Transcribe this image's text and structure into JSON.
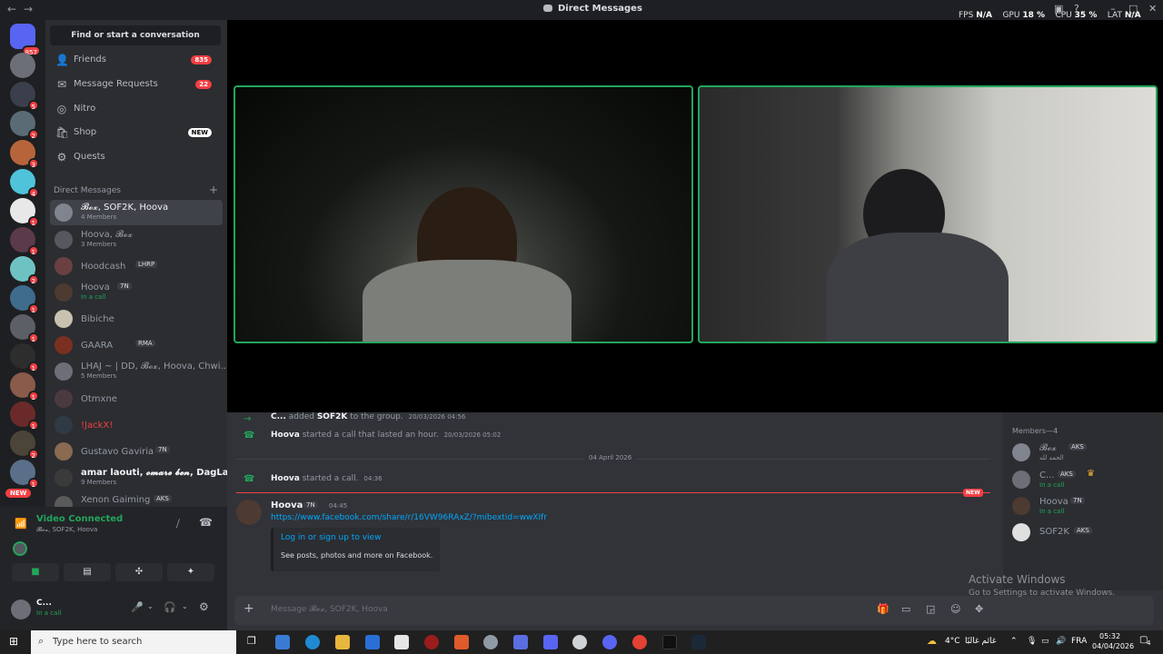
{
  "titlebar": {
    "back": "←",
    "forward": "→",
    "title": "Direct Messages",
    "fps_label": "FPS",
    "fps_value": "N/A",
    "gpu_label": "GPU",
    "gpu_value": "18 %",
    "cpu_label": "CPU",
    "cpu_value": "35 %",
    "lat_label": "LAT",
    "lat_value": "N/A"
  },
  "servers": {
    "home_badge": "857",
    "badges": [
      "5",
      "2",
      "3",
      "4",
      "1",
      "1",
      "2",
      "1",
      "1",
      "1",
      "1",
      "1",
      "2",
      "1"
    ],
    "new_label": "NEW"
  },
  "sidebar": {
    "find": "Find or start a conversation",
    "nav": [
      {
        "label": "Friends",
        "count": "835",
        "icon": "friends-icon"
      },
      {
        "label": "Message Requests",
        "count": "22",
        "icon": "mail-icon"
      },
      {
        "label": "Nitro",
        "icon": "nitro-icon"
      },
      {
        "label": "Shop",
        "new": "NEW",
        "icon": "shop-icon"
      },
      {
        "label": "Quests",
        "icon": "quests-icon"
      }
    ],
    "dm_header": "Direct Messages",
    "dms": [
      {
        "name": "𝓑𝓸𝔁, SOF2K, Hoova",
        "sub": "4 Members"
      },
      {
        "name": "Hoova, 𝓑𝓸𝔁",
        "sub": "3 Members"
      },
      {
        "name": "Hoodcash",
        "tag": "LHRP"
      },
      {
        "name": "Hoova",
        "tag": "7N",
        "sub": "In a call"
      },
      {
        "name": "Bibiche"
      },
      {
        "name": "GAARA",
        "tag": "RMA"
      },
      {
        "name": "LHAJ ~ | DD, 𝓑𝓸𝔁, Hoova, Chwi...",
        "sub": "5 Members"
      },
      {
        "name": "Otmxne"
      },
      {
        "name": "!JackX!"
      },
      {
        "name": "Gustavo Gaviria",
        "tag": "7N"
      },
      {
        "name": "amar laouti, 𝓸𝓶𝓪𝓻𝓮 𝓫𝓮𝓷, DagLa,...",
        "sub": "9 Members"
      },
      {
        "name": "Xenon Gaiming",
        "tag": "AKS"
      }
    ]
  },
  "voice": {
    "status": "Video Connected",
    "channel": "𝓑𝓸𝔁, SOF2K, Hoova"
  },
  "user": {
    "name": "C...",
    "status": "In a call"
  },
  "chat": {
    "lines": [
      {
        "name": "C...",
        "text": "added",
        "target": "SOF2K",
        "rest": "to the group.",
        "time": "20/03/2026 04:56"
      },
      {
        "name": "Hoova",
        "text": "started a call that lasted an hour.",
        "time": "20/03/2026 05:02"
      },
      {
        "name": "Hoova",
        "text": "started a call.",
        "time": "04:36"
      }
    ],
    "date_divider": "04 April 2026",
    "new_label": "NEW",
    "message": {
      "author": "Hoova",
      "tag": "7N",
      "time": "04:45",
      "link": "https://www.facebook.com/share/r/16VW96RAxZ/?mibextid=wwXIfr",
      "embed_title": "Log in or sign up to view",
      "embed_desc": "See posts, photos and more on Facebook."
    },
    "placeholder": "Message 𝓑𝓸𝔁, SOF2K, Hoova"
  },
  "members": {
    "header": "Members—4",
    "list": [
      {
        "name": "𝓑𝓸𝔁",
        "tag": "AKS",
        "sub": "الحمد لله"
      },
      {
        "name": "C...",
        "tag": "AKS",
        "sub": "In a call"
      },
      {
        "name": "Hoova",
        "tag": "7N",
        "sub": "In a call"
      },
      {
        "name": "SOF2K",
        "tag": "AKS"
      }
    ]
  },
  "watermark": {
    "title": "Activate Windows",
    "sub": "Go to Settings to activate Windows."
  },
  "taskbar": {
    "search": "Type here to search",
    "weather": "4°C",
    "weather_text": "غائم غالبًا",
    "lang": "FRA",
    "time": "05:32",
    "date": "04/04/2026",
    "notif": "4"
  },
  "colors": {
    "green": "#23a55a",
    "red": "#f23f43",
    "blurple": "#5865f2",
    "link": "#00a8fc"
  }
}
